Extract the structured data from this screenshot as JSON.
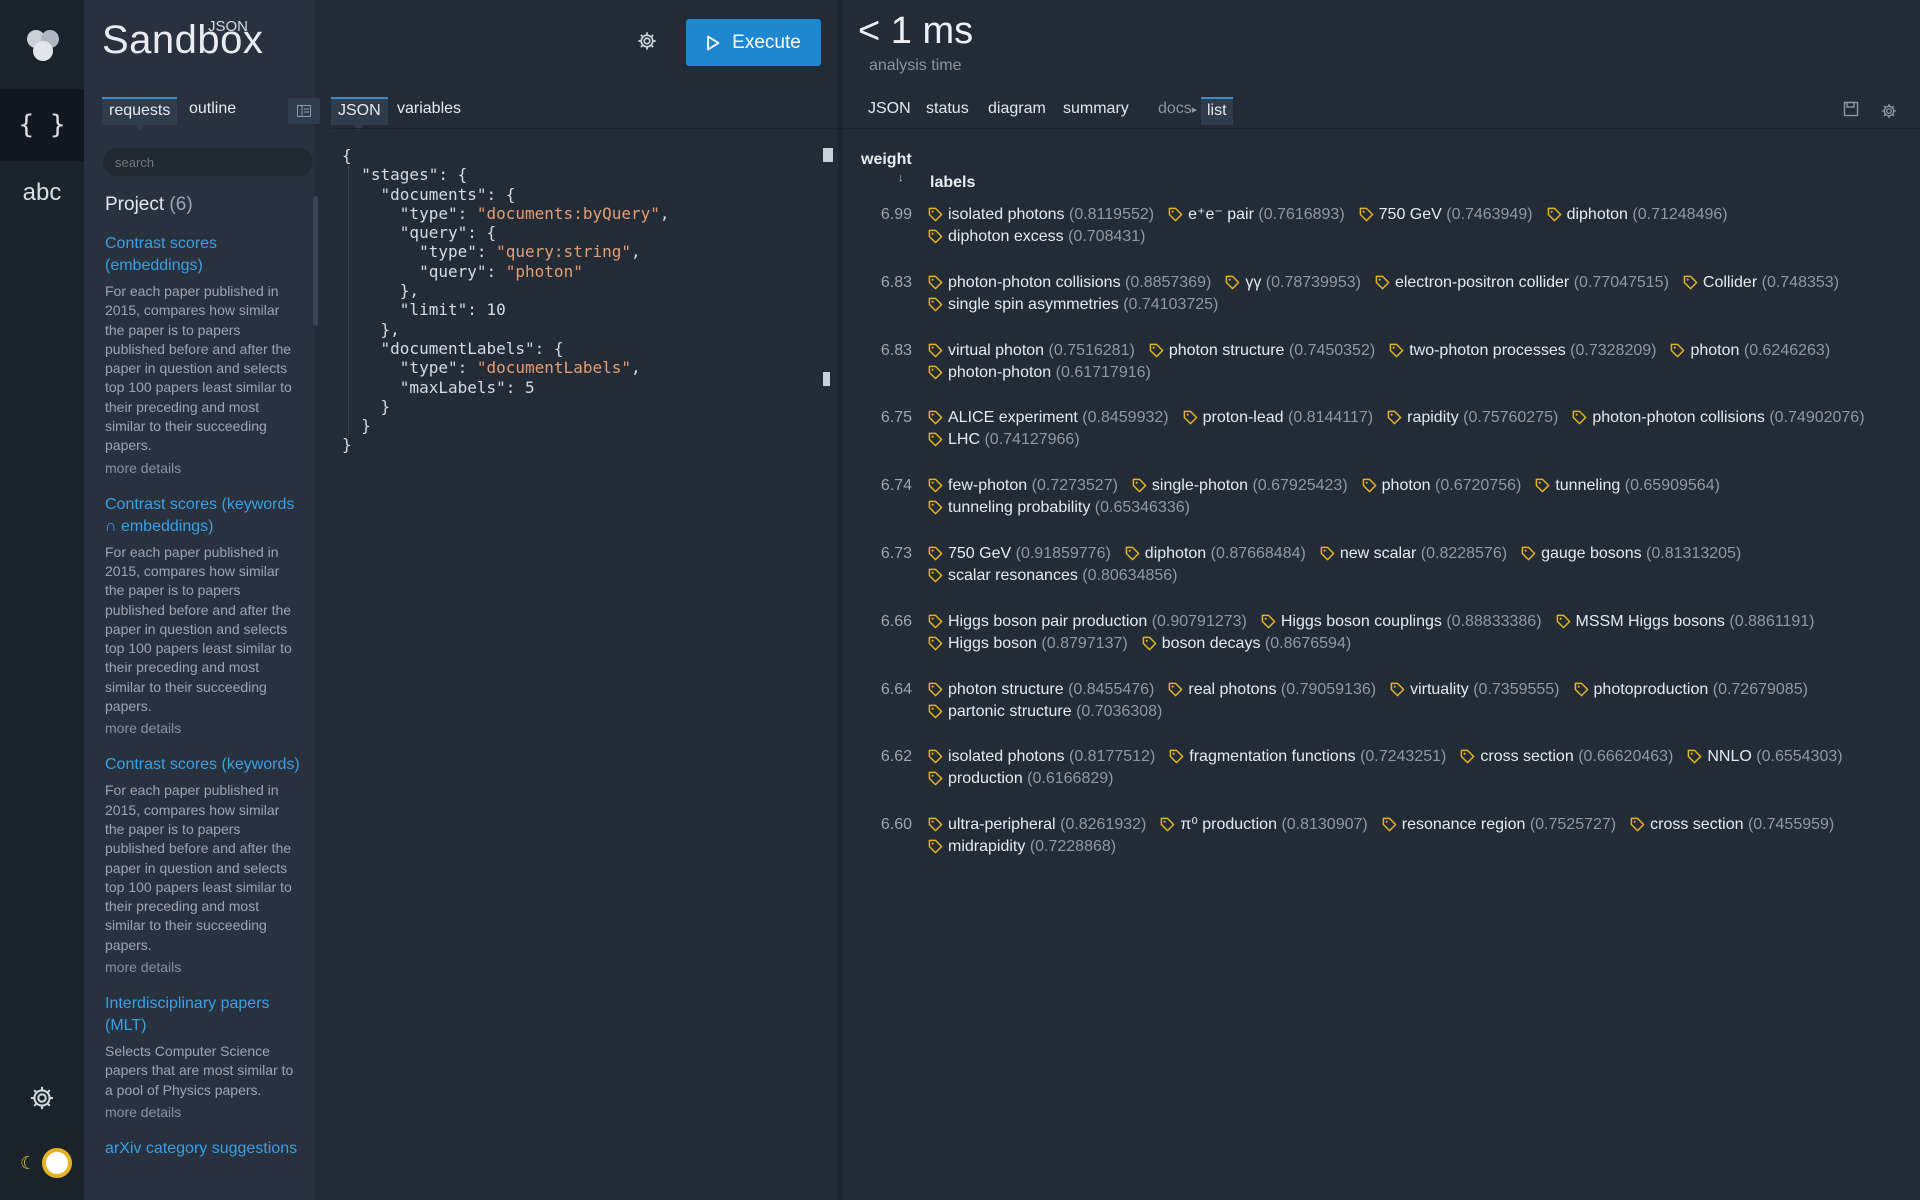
{
  "app": {
    "title_big": "Sandbox",
    "title_small": "JSON"
  },
  "toolbar": {
    "execute_label": "Execute"
  },
  "analysis": {
    "time": "< 1 ms",
    "label": "analysis time"
  },
  "left_tabs": [
    "requests",
    "outline"
  ],
  "editor_tabs": [
    "JSON",
    "variables"
  ],
  "search": {
    "placeholder": "search"
  },
  "project": {
    "label": "Project",
    "count": "(6)"
  },
  "requests": [
    {
      "title": "Contrast scores (embeddings)",
      "desc": "For each paper published in 2015, compares how similar the paper is to papers published before and after the paper in question and selects top 100 papers least similar to their preceding and most similar to their succeeding papers.",
      "more": "more details"
    },
    {
      "title": "Contrast scores (keywords ∩ embeddings)",
      "desc": "For each paper published in 2015, compares how similar the paper is to papers published before and after the paper in question and selects top 100 papers least similar to their preceding and most similar to their succeeding papers.",
      "more": "more details"
    },
    {
      "title": "Contrast scores (keywords)",
      "desc": "For each paper published in 2015, compares how similar the paper is to papers published before and after the paper in question and selects top 100 papers least similar to their preceding and most similar to their succeeding papers.",
      "more": "more details"
    },
    {
      "title": "Interdisciplinary papers (MLT)",
      "desc": "Selects Computer Science papers that are most similar to a pool of Physics papers.",
      "more": "more details"
    },
    {
      "title": "arXiv category suggestions",
      "desc": "",
      "more": ""
    }
  ],
  "code_lines": [
    [
      [
        "p",
        "{"
      ]
    ],
    [
      [
        "p",
        "  \"stages\": {"
      ]
    ],
    [
      [
        "p",
        "    \"documents\": {"
      ]
    ],
    [
      [
        "p",
        "      \"type\": "
      ],
      [
        "s",
        "\"documents:byQuery\""
      ],
      [
        "p",
        ","
      ]
    ],
    [
      [
        "p",
        "      \"query\": {"
      ]
    ],
    [
      [
        "p",
        "        \"type\": "
      ],
      [
        "s",
        "\"query:string\""
      ],
      [
        "p",
        ","
      ]
    ],
    [
      [
        "p",
        "        \"query\": "
      ],
      [
        "s",
        "\"photon\""
      ]
    ],
    [
      [
        "p",
        "      },"
      ]
    ],
    [
      [
        "p",
        "      \"limit\": 10"
      ]
    ],
    [
      [
        "p",
        "    },"
      ]
    ],
    [
      [
        "p",
        "    \"documentLabels\": {"
      ]
    ],
    [
      [
        "p",
        "      \"type\": "
      ],
      [
        "s",
        "\"documentLabels\""
      ],
      [
        "p",
        ","
      ]
    ],
    [
      [
        "p",
        "      \"maxLabels\": 5"
      ]
    ],
    [
      [
        "p",
        "    }"
      ]
    ],
    [
      [
        "p",
        "  }"
      ]
    ],
    [
      [
        "p",
        "}"
      ]
    ]
  ],
  "right_tabs": {
    "json": "JSON",
    "status": "status",
    "diagram": "diagram",
    "summary": "summary",
    "docs": "docs",
    "list": "list"
  },
  "list": {
    "col_weight": "weight",
    "col_labels": "labels",
    "rows": [
      {
        "weight": "6.99",
        "labels": [
          [
            "isolated photons",
            "(0.8119552)"
          ],
          [
            "e⁺e⁻ pair",
            "(0.7616893)"
          ],
          [
            "750 GeV",
            "(0.7463949)"
          ],
          [
            "diphoton",
            "(0.71248496)"
          ],
          [
            "diphoton excess",
            "(0.708431)"
          ]
        ]
      },
      {
        "weight": "6.83",
        "labels": [
          [
            "photon-photon collisions",
            "(0.8857369)"
          ],
          [
            "γγ",
            "(0.78739953)"
          ],
          [
            "electron-positron collider",
            "(0.77047515)"
          ],
          [
            "Collider",
            "(0.748353)"
          ],
          [
            "single spin asymmetries",
            "(0.74103725)"
          ]
        ]
      },
      {
        "weight": "6.83",
        "labels": [
          [
            "virtual photon",
            "(0.7516281)"
          ],
          [
            "photon structure",
            "(0.7450352)"
          ],
          [
            "two-photon processes",
            "(0.7328209)"
          ],
          [
            "photon",
            "(0.6246263)"
          ],
          [
            "photon-photon",
            "(0.61717916)"
          ]
        ]
      },
      {
        "weight": "6.75",
        "labels": [
          [
            "ALICE experiment",
            "(0.8459932)"
          ],
          [
            "proton-lead",
            "(0.8144117)"
          ],
          [
            "rapidity",
            "(0.75760275)"
          ],
          [
            "photon-photon collisions",
            "(0.74902076)"
          ],
          [
            "LHC",
            "(0.74127966)"
          ]
        ]
      },
      {
        "weight": "6.74",
        "labels": [
          [
            "few-photon",
            "(0.7273527)"
          ],
          [
            "single-photon",
            "(0.67925423)"
          ],
          [
            "photon",
            "(0.6720756)"
          ],
          [
            "tunneling",
            "(0.65909564)"
          ],
          [
            "tunneling probability",
            "(0.65346336)"
          ]
        ]
      },
      {
        "weight": "6.73",
        "labels": [
          [
            "750 GeV",
            "(0.91859776)"
          ],
          [
            "diphoton",
            "(0.87668484)"
          ],
          [
            "new scalar",
            "(0.8228576)"
          ],
          [
            "gauge bosons",
            "(0.81313205)"
          ],
          [
            "scalar resonances",
            "(0.80634856)"
          ]
        ]
      },
      {
        "weight": "6.66",
        "labels": [
          [
            "Higgs boson pair production",
            "(0.90791273)"
          ],
          [
            "Higgs boson couplings",
            "(0.88833386)"
          ],
          [
            "MSSM Higgs bosons",
            "(0.8861191)"
          ],
          [
            "Higgs boson",
            "(0.8797137)"
          ],
          [
            "boson decays",
            "(0.8676594)"
          ]
        ]
      },
      {
        "weight": "6.64",
        "labels": [
          [
            "photon structure",
            "(0.8455476)"
          ],
          [
            "real photons",
            "(0.79059136)"
          ],
          [
            "virtuality",
            "(0.7359555)"
          ],
          [
            "photoproduction",
            "(0.72679085)"
          ],
          [
            "partonic structure",
            "(0.7036308)"
          ]
        ]
      },
      {
        "weight": "6.62",
        "labels": [
          [
            "isolated photons",
            "(0.8177512)"
          ],
          [
            "fragmentation functions",
            "(0.7243251)"
          ],
          [
            "cross section",
            "(0.66620463)"
          ],
          [
            "NNLO",
            "(0.6554303)"
          ],
          [
            "production",
            "(0.6166829)"
          ]
        ]
      },
      {
        "weight": "6.60",
        "labels": [
          [
            "ultra-peripheral",
            "(0.8261932)"
          ],
          [
            "π⁰ production",
            "(0.8130907)"
          ],
          [
            "resonance region",
            "(0.7525727)"
          ],
          [
            "cross section",
            "(0.7455959)"
          ],
          [
            "midrapidity",
            "(0.7228868)"
          ]
        ]
      }
    ]
  },
  "colors": {
    "accent": "#1f86d0",
    "link": "#39a0e6",
    "tag_icon": "#e6b422",
    "string": "#e59e73"
  }
}
